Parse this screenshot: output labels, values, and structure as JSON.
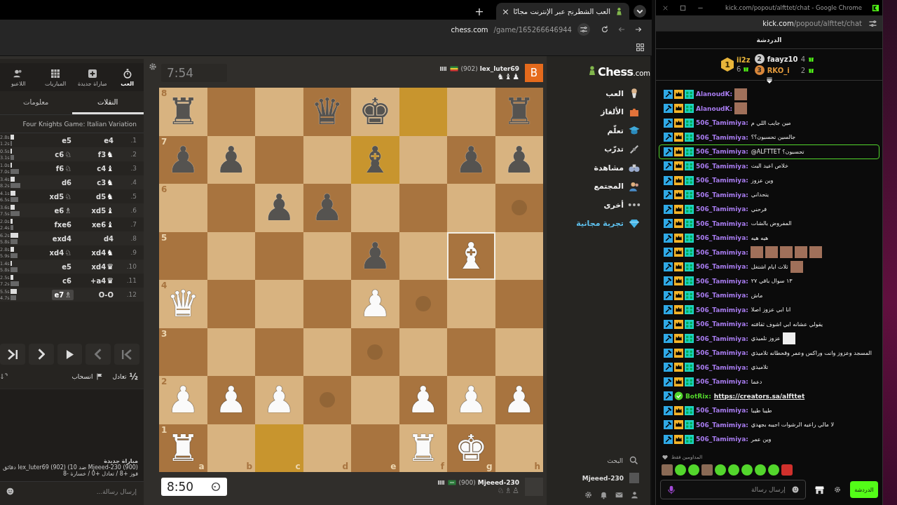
{
  "browser": {
    "tab_title": "العب الشطرنج عبر الإنترنت مجانًا",
    "tab_close": "×",
    "new_tab": "+",
    "url_host": "chess.com",
    "url_path": "/game/165266646944"
  },
  "left_panel": {
    "nav": [
      {
        "label": "العب",
        "kind": "stopwatch",
        "selected": true
      },
      {
        "label": "مباراة جديدة",
        "kind": "plus",
        "selected": false
      },
      {
        "label": "المباريات",
        "kind": "grid",
        "selected": false
      },
      {
        "label": "اللاعبو",
        "kind": "players",
        "selected": false
      }
    ],
    "tabs": [
      {
        "label": "النقلات",
        "selected": true
      },
      {
        "label": "معلومات",
        "selected": false
      }
    ],
    "opening": "Four Knights Game: Italian Variation",
    "moves": [
      {
        "number": "1.",
        "white": {
          "san": "e4",
          "selected": false
        },
        "black": {
          "san": "e5",
          "selected": false
        },
        "white_time": "2.8s",
        "black_time": "1.2s"
      },
      {
        "number": "2.",
        "white": {
          "san": "f3",
          "figurine": "♞",
          "selected": false
        },
        "black": {
          "san": "c6",
          "figurine": "♘",
          "selected": false
        },
        "white_time": "0.5s",
        "black_time": "3.1s"
      },
      {
        "number": "3.",
        "white": {
          "san": "c4",
          "figurine": "♝",
          "selected": false
        },
        "black": {
          "san": "f6",
          "figurine": "♘",
          "selected": false
        },
        "white_time": "1.0s",
        "black_time": "7.0s"
      },
      {
        "number": "4.",
        "white": {
          "san": "c3",
          "figurine": "♞",
          "selected": false
        },
        "black": {
          "san": "d6",
          "selected": false
        },
        "white_time": "3.4s",
        "black_time": "8.2s"
      },
      {
        "number": "5.",
        "white": {
          "san": "d5",
          "figurine": "♞",
          "selected": false
        },
        "black": {
          "san": "xd5",
          "figurine": "♘",
          "selected": false
        },
        "white_time": "4.1s",
        "black_time": "6.5s"
      },
      {
        "number": "6.",
        "white": {
          "san": "xd5",
          "figurine": "♝",
          "selected": false
        },
        "black": {
          "san": "e6",
          "figurine": "♗",
          "selected": false
        },
        "white_time": "3.6s",
        "black_time": "7.5s"
      },
      {
        "number": "7.",
        "white": {
          "san": "xe6",
          "figurine": "♝",
          "selected": false
        },
        "black": {
          "san": "fxe6",
          "selected": false
        },
        "white_time": "2.0s",
        "black_time": "2.4s"
      },
      {
        "number": "8.",
        "white": {
          "san": "d4",
          "selected": false
        },
        "black": {
          "san": "exd4",
          "selected": false
        },
        "white_time": "6.2s",
        "black_time": "5.8s"
      },
      {
        "number": "9.",
        "white": {
          "san": "xd4",
          "figurine": "♞",
          "selected": false
        },
        "black": {
          "san": "xd4",
          "figurine": "♘",
          "selected": false
        },
        "white_time": "2.8s",
        "black_time": "5.9s"
      },
      {
        "number": "10.",
        "white": {
          "san": "xd4",
          "figurine": "♛",
          "selected": false
        },
        "black": {
          "san": "e5",
          "selected": false
        },
        "white_time": "1.4s",
        "black_time": "5.8s"
      },
      {
        "number": "11.",
        "white": {
          "san": "a4+",
          "figurine": "♛",
          "selected": false
        },
        "black": {
          "san": "c6",
          "selected": false
        },
        "white_time": "2.5s",
        "black_time": "7.2s"
      },
      {
        "number": "12.",
        "white": {
          "san": "O-O",
          "selected": false
        },
        "black": {
          "san": "e7",
          "figurine": "♗",
          "selected": true
        },
        "white_time": "5.5s",
        "black_time": "4.7s"
      }
    ],
    "controls": [
      {
        "kind": "first"
      },
      {
        "kind": "prev"
      },
      {
        "kind": "play"
      },
      {
        "kind": "next"
      },
      {
        "kind": "last"
      }
    ],
    "actions": [
      {
        "icon": "½",
        "label": "تعادل",
        "kind": "draw"
      },
      {
        "label": "انسحاب",
        "kind": "resign"
      }
    ],
    "chat": {
      "title": "مباراة جديدة",
      "line": "Mjeeed-230 (900) ضد lex_luter69 (902) (10 دقائق",
      "record": "فوز +8 / تعادل +0 / خسارة -8",
      "placeholder": "إرسال رسالة..."
    }
  },
  "game": {
    "top_player": {
      "name": "lex_luter69",
      "rating": "(902)",
      "avatar": "B",
      "captured": [
        "♟",
        "♝",
        "♞"
      ]
    },
    "top_clock": {
      "time": "7:54",
      "active": false
    },
    "bottom_player": {
      "name": "Mjeeed-230",
      "rating": "(900)",
      "captured": [
        "♙",
        "♗",
        "♘"
      ]
    },
    "bottom_clock": {
      "time": "8:50",
      "active": true
    },
    "board": {
      "rank_labels": [
        "8",
        "7",
        "6",
        "5",
        "4",
        "3",
        "2",
        "1"
      ],
      "file_labels": [
        "h",
        "g",
        "f",
        "e",
        "d",
        "c",
        "b",
        "a"
      ],
      "rows": [
        [
          {
            "piece": "♜",
            "white": false,
            "kind": "plain"
          },
          {
            "kind": "plain"
          },
          {
            "kind": "last_move"
          },
          {
            "piece": "♚",
            "white": false,
            "kind": "plain"
          },
          {
            "piece": "♛",
            "white": false,
            "kind": "plain"
          },
          {
            "kind": "plain"
          },
          {
            "kind": "plain"
          },
          {
            "piece": "♜",
            "white": false,
            "kind": "plain"
          }
        ],
        [
          {
            "piece": "♟",
            "white": false,
            "kind": "plain"
          },
          {
            "piece": "♟",
            "white": false,
            "kind": "plain"
          },
          {
            "kind": "plain"
          },
          {
            "piece": "♝",
            "white": false,
            "kind": "last_move"
          },
          {
            "kind": "plain"
          },
          {
            "kind": "plain"
          },
          {
            "piece": "♟",
            "white": false,
            "kind": "plain"
          },
          {
            "piece": "♟",
            "white": false,
            "kind": "plain"
          }
        ],
        [
          {
            "kind": "hint"
          },
          {
            "kind": "plain"
          },
          {
            "kind": "plain"
          },
          {
            "kind": "plain"
          },
          {
            "piece": "♟",
            "white": false,
            "kind": "plain"
          },
          {
            "piece": "♟",
            "white": false,
            "kind": "plain"
          },
          {
            "kind": "plain"
          },
          {
            "kind": "plain"
          }
        ],
        [
          {
            "kind": "plain"
          },
          {
            "piece": "♝",
            "white": true,
            "kind": "selected"
          },
          {
            "kind": "plain"
          },
          {
            "piece": "♟",
            "white": false,
            "kind": "plain"
          },
          {
            "kind": "plain"
          },
          {
            "kind": "plain"
          },
          {
            "kind": "plain"
          },
          {
            "kind": "plain"
          }
        ],
        [
          {
            "kind": "plain"
          },
          {
            "kind": "plain"
          },
          {
            "kind": "hint"
          },
          {
            "piece": "♟",
            "white": true,
            "kind": "plain"
          },
          {
            "kind": "plain"
          },
          {
            "kind": "plain"
          },
          {
            "kind": "plain"
          },
          {
            "piece": "♛",
            "white": true,
            "kind": "plain"
          }
        ],
        [
          {
            "kind": "plain"
          },
          {
            "kind": "plain"
          },
          {
            "kind": "plain"
          },
          {
            "kind": "hint"
          },
          {
            "kind": "plain"
          },
          {
            "kind": "plain"
          },
          {
            "kind": "plain"
          },
          {
            "kind": "plain"
          }
        ],
        [
          {
            "piece": "♟",
            "white": true,
            "kind": "plain"
          },
          {
            "piece": "♟",
            "white": true,
            "kind": "plain"
          },
          {
            "piece": "♟",
            "white": true,
            "kind": "plain"
          },
          {
            "kind": "plain"
          },
          {
            "kind": "hint"
          },
          {
            "piece": "♟",
            "white": true,
            "kind": "plain"
          },
          {
            "piece": "♟",
            "white": true,
            "kind": "plain"
          },
          {
            "piece": "♟",
            "white": true,
            "kind": "plain"
          }
        ],
        [
          {
            "kind": "plain"
          },
          {
            "piece": "♚",
            "white": true,
            "kind": "plain"
          },
          {
            "piece": "♜",
            "white": true,
            "kind": "plain"
          },
          {
            "kind": "plain"
          },
          {
            "kind": "plain"
          },
          {
            "kind": "last_move"
          },
          {
            "kind": "plain"
          },
          {
            "piece": "♜",
            "white": true,
            "kind": "plain"
          }
        ]
      ]
    }
  },
  "site_nav": {
    "logo": "Chess",
    "logo_suffix": ".com",
    "items": [
      {
        "label": "العب",
        "kind": "play"
      },
      {
        "label": "الألغاز",
        "kind": "puzzle"
      },
      {
        "label": "تعلّم",
        "kind": "learn"
      },
      {
        "label": "تدرّب",
        "kind": "train"
      },
      {
        "label": "مشاهدة",
        "kind": "watch"
      },
      {
        "label": "المجتمع",
        "kind": "community"
      },
      {
        "label": "أخرى",
        "kind": "more"
      },
      {
        "label": "تجربة مجانية",
        "kind": "promo"
      }
    ],
    "search": "البحث",
    "user": "Mjeeed-230"
  },
  "chat_window": {
    "title": "kick.com/popout/alfttet/chat - Google Chrome",
    "url_host": "kick.com",
    "url_path": "/popout/alfttet/chat",
    "header": "الدردشة",
    "leaders": [
      {
        "rank": "2",
        "name": "faayz10",
        "count": "4",
        "color": "#e6e6e6"
      },
      {
        "rank": "3",
        "name": "RKO_i",
        "count": "2",
        "color": "#e39a3c"
      },
      {
        "rank": "1",
        "name": "ii2z",
        "count": "6",
        "color": "#e8b53a"
      }
    ],
    "messages": [
      {
        "kind": "user",
        "user": "AlanoudK:",
        "color": "#a87cf0",
        "highlighted": false,
        "emotes": [
          {
            "kind": "photo"
          }
        ]
      },
      {
        "kind": "user",
        "user": "AlanoudK:",
        "color": "#a87cf0",
        "highlighted": false,
        "emotes": [
          {
            "kind": "photo"
          }
        ]
      },
      {
        "kind": "user",
        "user": "506_Tamimiya:",
        "color": "#a87cf0",
        "text": "مين جايب اللي م",
        "highlighted": false
      },
      {
        "kind": "user",
        "user": "506_Tamimiya:",
        "color": "#a87cf0",
        "text": "جالسين تحسبون؟؟",
        "highlighted": false
      },
      {
        "kind": "user",
        "user": "506_Tamimiya:",
        "color": "#a87cf0",
        "text": "@ALFTTET تحسبون؟",
        "highlighted": true
      },
      {
        "kind": "user",
        "user": "506_Tamimiya:",
        "color": "#a87cf0",
        "text": "خلاص اعيد البث",
        "highlighted": false
      },
      {
        "kind": "user",
        "user": "506_Tamimiya:",
        "color": "#a87cf0",
        "text": "وين عزوز",
        "highlighted": false
      },
      {
        "kind": "user",
        "user": "506_Tamimiya:",
        "color": "#a87cf0",
        "text": "يتحداني",
        "highlighted": false
      },
      {
        "kind": "user",
        "user": "506_Tamimiya:",
        "color": "#a87cf0",
        "text": "فرحني",
        "highlighted": false
      },
      {
        "kind": "user",
        "user": "506_Tamimiya:",
        "color": "#a87cf0",
        "text": "المفروض بالشات",
        "highlighted": false
      },
      {
        "kind": "user",
        "user": "506_Tamimiya:",
        "color": "#a87cf0",
        "text": "هيه هيه",
        "highlighted": false
      },
      {
        "kind": "user",
        "user": "506_Tamimiya:",
        "color": "#a87cf0",
        "highlighted": false,
        "emotes": [
          {
            "kind": "photo"
          },
          {
            "kind": "photo"
          },
          {
            "kind": "photo"
          },
          {
            "kind": "photo"
          },
          {
            "kind": "photo"
          }
        ]
      },
      {
        "kind": "user",
        "user": "506_Tamimiya:",
        "color": "#a87cf0",
        "text": "ثلاث ايام اشتغل",
        "highlighted": false,
        "emotes": [
          {
            "kind": "photo"
          }
        ]
      },
      {
        "kind": "user",
        "user": "506_Tamimiya:",
        "color": "#a87cf0",
        "text": "١٣ سوال باقي ٢٧",
        "highlighted": false
      },
      {
        "kind": "user",
        "user": "506_Tamimiya:",
        "color": "#a87cf0",
        "text": "ماش",
        "highlighted": false
      },
      {
        "kind": "user",
        "user": "506_Tamimiya:",
        "color": "#a87cf0",
        "text": "انا ابي عزوز اصلا",
        "highlighted": false
      },
      {
        "kind": "user",
        "user": "506_Tamimiya:",
        "color": "#a87cf0",
        "text": "يقولي عشانه ابي اشوف ثقافته",
        "highlighted": false
      },
      {
        "kind": "user",
        "user": "506_Tamimiya:",
        "color": "#a87cf0",
        "text": "عزوز تلميذي",
        "highlighted": false,
        "emotes": [
          {
            "kind": "drawing"
          }
        ]
      },
      {
        "kind": "user",
        "user": "506_Tamimiya:",
        "color": "#a87cf0",
        "text": "المسجد وعزوز وانت وراكس وعمر وقحطانه تلاميذي",
        "highlighted": false
      },
      {
        "kind": "user",
        "user": "506_Tamimiya:",
        "color": "#a87cf0",
        "text": "تلاميذي",
        "highlighted": false
      },
      {
        "kind": "user",
        "user": "506_Tamimiya:",
        "color": "#a87cf0",
        "text": "دعما",
        "highlighted": false
      },
      {
        "kind": "bot",
        "user": "BotRix:",
        "color": "#53d62c",
        "link": "https://creators.sa/alfttet",
        "highlighted": false
      },
      {
        "kind": "user",
        "user": "506_Tamimiya:",
        "color": "#a87cf0",
        "text": "طيبا طيبا",
        "highlighted": false
      },
      {
        "kind": "user",
        "user": "506_Tamimiya:",
        "color": "#a87cf0",
        "text": "لا مالي راعيه الرشوات اجيبه بجهدي",
        "highlighted": false
      },
      {
        "kind": "user",
        "user": "506_Tamimiya:",
        "color": "#a87cf0",
        "text": "وين عمر",
        "highlighted": false
      }
    ],
    "subscribers_label": "المداومين فقط",
    "emote_bar": [
      {
        "kind": "photo"
      },
      {
        "kind": "blob"
      },
      {
        "kind": "blob"
      },
      {
        "kind": "photo"
      },
      {
        "kind": "blob"
      },
      {
        "kind": "blob"
      },
      {
        "kind": "blob"
      },
      {
        "kind": "blob"
      },
      {
        "kind": "blob"
      },
      {
        "kind": "red"
      }
    ],
    "placeholder": "إرسال رسالة",
    "send": "الدردشة"
  }
}
